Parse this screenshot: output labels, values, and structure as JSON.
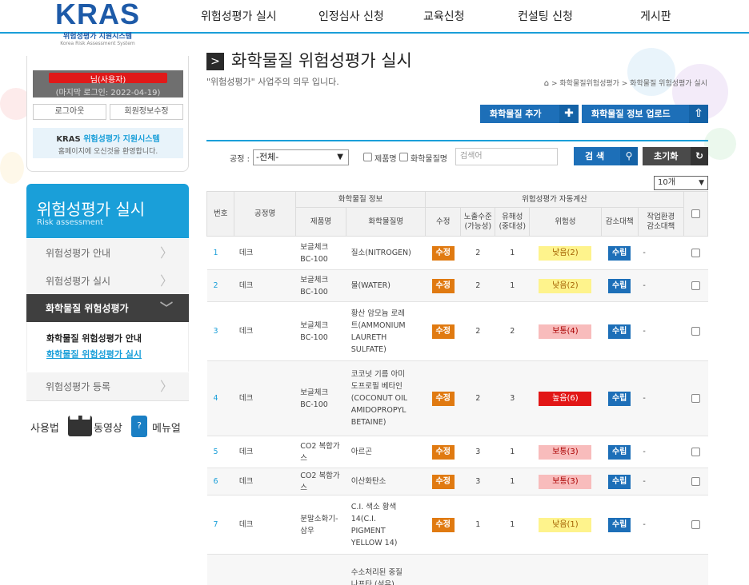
{
  "nav": {
    "items": [
      "위험성평가 실시",
      "인정심사 신청",
      "교육신청",
      "컨설팅 신청",
      "게시판"
    ]
  },
  "logo": {
    "main": "KRAS",
    "ko": "위험성평가 지원시스템",
    "en": "Korea Risk Assessment System"
  },
  "login": {
    "user_suffix": "님(사용자)",
    "last_login": "(마지막 로그인: 2022-04-19)",
    "logout_label": "로그아웃",
    "edit_label": "회원정보수정",
    "kras_prefix": "KRAS",
    "kras_highlight": "위험성평가 지원시스템",
    "welcome": "홈페이지에 오신것을 환영합니다."
  },
  "side": {
    "title": "위험성평가 실시",
    "subtitle": "Risk assessment",
    "items": [
      "위험성평가 안내",
      "위험성평가 실시",
      "화학물질 위험성평가",
      "위험성평가 등록"
    ],
    "sub_items": [
      "화학물질 위험성평가 안내",
      "화학물질 위험성평가 실시"
    ]
  },
  "quick": {
    "usage": "사용법",
    "video": "동영상",
    "manual": "메뉴얼"
  },
  "main": {
    "title": "화학물질 위험성평가 실시",
    "subtitle": "\"위험성평가\" 사업주의 의무 입니다.",
    "breadcrumb": "> 화학물질위험성평가 > 화학물질 위험성평가 실시",
    "add_label": "화학물질 추가",
    "upload_label": "화학물질 정보 업로드"
  },
  "search": {
    "process_label": "공정 :",
    "process_value": "-전체-",
    "product_label": "제품명",
    "chemical_label": "화학물질명",
    "placeholder": "검색어",
    "search_label": "검 색",
    "reset_label": "초기화",
    "page_size": "10개"
  },
  "table": {
    "head": {
      "no": "번호",
      "process": "공정명",
      "chem_info": "화학물질 정보",
      "product": "제품명",
      "chemical": "화학물질명",
      "auto_calc": "위험성평가 자동계산",
      "edit": "수정",
      "exposure": "노출수준\n(가능성)",
      "hazard": "유해성\n(중대성)",
      "risk": "위험성",
      "measure": "감소대책",
      "work_env": "작업환경\n감소대책"
    },
    "edit_btn": "수정",
    "est_btn": "수립",
    "rows": [
      {
        "no": "1",
        "process": "데크",
        "product": "보글체크\nBC-100",
        "chemical": "질소(NITROGEN)",
        "exposure": "2",
        "hazard": "1",
        "risk": "낮음(2)",
        "level": "low",
        "env": "-"
      },
      {
        "no": "2",
        "process": "데크",
        "product": "보글체크\nBC-100",
        "chemical": "물(WATER)",
        "exposure": "2",
        "hazard": "1",
        "risk": "낮음(2)",
        "level": "low",
        "env": "-"
      },
      {
        "no": "3",
        "process": "데크",
        "product": "보글체크\nBC-100",
        "chemical": "황산 암모늄 로레\n트(AMMONIUM\nLAURETH\nSULFATE)",
        "exposure": "2",
        "hazard": "2",
        "risk": "보통(4)",
        "level": "mid",
        "env": "-"
      },
      {
        "no": "4",
        "process": "데크",
        "product": "보글체크\nBC-100",
        "chemical": "코코넛 기름 아미\n도프로필 베타인\n(COCONUT OIL\nAMIDOPROPYL\nBETAINE)",
        "exposure": "2",
        "hazard": "3",
        "risk": "높음(6)",
        "level": "high",
        "env": "-"
      },
      {
        "no": "5",
        "process": "데크",
        "product": "CO2 복합가\n스",
        "chemical": "아르곤",
        "exposure": "3",
        "hazard": "1",
        "risk": "보통(3)",
        "level": "mid",
        "env": "-"
      },
      {
        "no": "6",
        "process": "데크",
        "product": "CO2 복합가\n스",
        "chemical": "이산화탄소",
        "exposure": "3",
        "hazard": "1",
        "risk": "보통(3)",
        "level": "mid",
        "env": "-"
      },
      {
        "no": "7",
        "process": "데크",
        "product": "분말소화기-\n삼우",
        "chemical": "C.I. 색소 황색\n14(C.I.\nPIGMENT\nYELLOW 14)",
        "exposure": "1",
        "hazard": "1",
        "risk": "낮음(1)",
        "level": "low",
        "env": "-"
      },
      {
        "no": "",
        "process": "",
        "product": "",
        "chemical": "수소처리된 중질\n나프타 (석유)",
        "exposure": "",
        "hazard": "",
        "risk": "",
        "level": "",
        "env": ""
      }
    ]
  }
}
